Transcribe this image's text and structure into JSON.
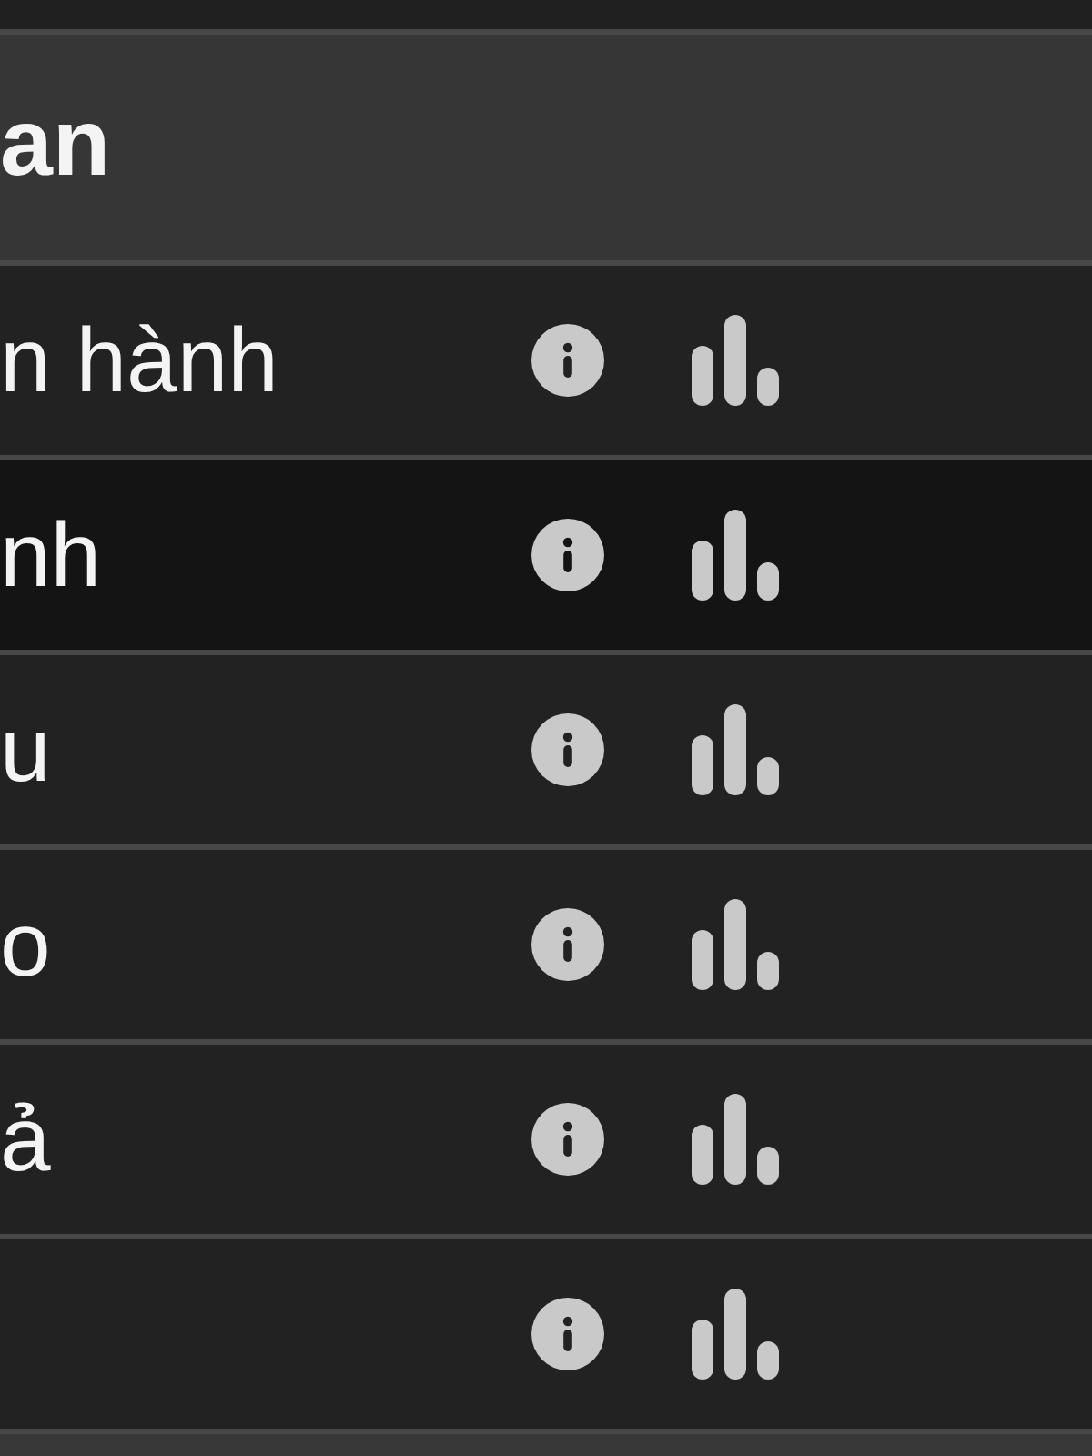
{
  "header": {
    "title": "an"
  },
  "rows": [
    {
      "label": "n hành",
      "selected": false
    },
    {
      "label": "nh",
      "selected": true
    },
    {
      "label": "u",
      "selected": false
    },
    {
      "label": "o",
      "selected": false
    },
    {
      "label": "ả",
      "selected": false
    },
    {
      "selected": false
    }
  ]
}
